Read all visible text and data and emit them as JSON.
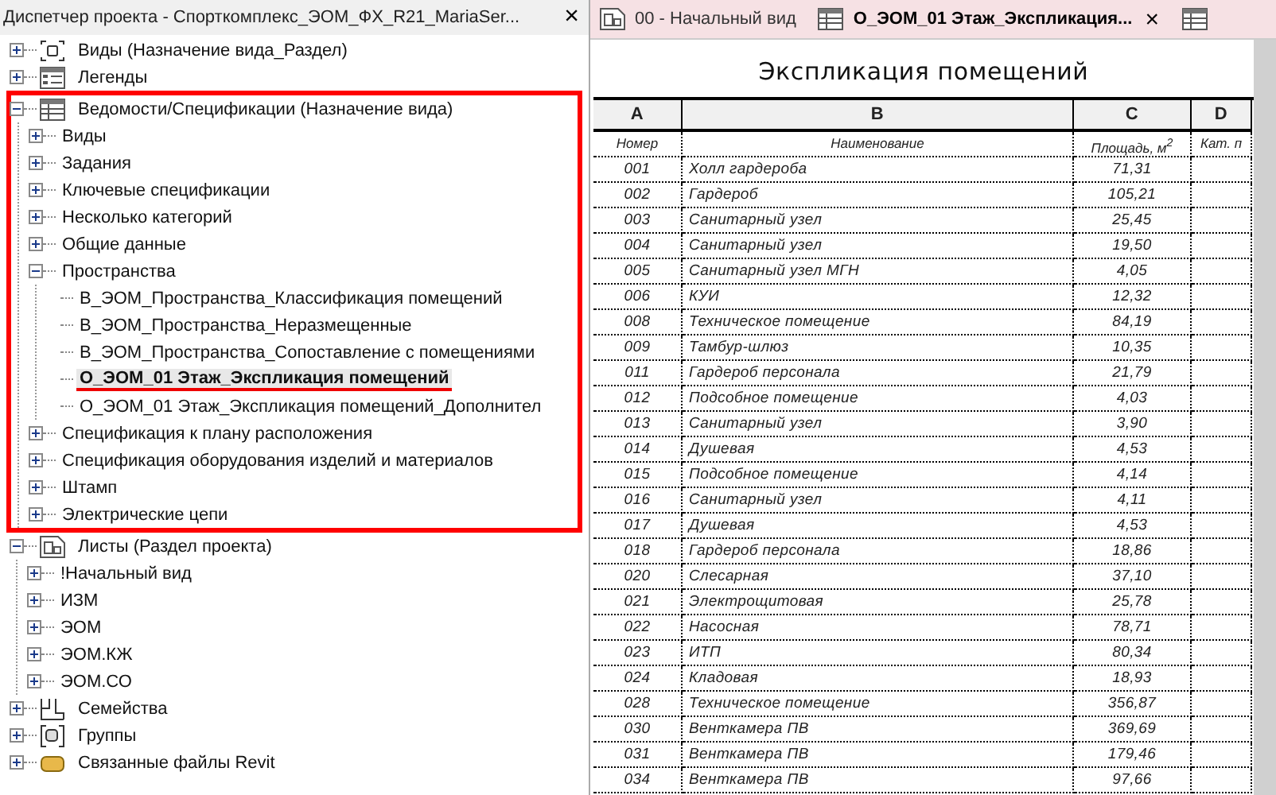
{
  "browser": {
    "title": "Диспетчер проекта - Спорткомплекс_ЭОМ_ФХ_R21_MariaSer...",
    "close": "×",
    "tree": [
      {
        "label": "Виды (Назначение вида_Раздел)",
        "kind": "views",
        "expanded": false,
        "selected": false
      },
      {
        "label": "Легенды",
        "kind": "legends",
        "expanded": false,
        "selected": false
      },
      {
        "label": "Ведомости/Спецификации (Назначение вида)",
        "kind": "schedules",
        "expanded": true,
        "selected": false,
        "highlighted": true,
        "children": [
          {
            "label": "Виды",
            "expanded": false,
            "selected": false
          },
          {
            "label": "Задания",
            "expanded": false,
            "selected": false
          },
          {
            "label": "Ключевые спецификации",
            "expanded": false,
            "selected": false
          },
          {
            "label": "Несколько категорий",
            "expanded": false,
            "selected": false
          },
          {
            "label": "Общие данные",
            "expanded": false,
            "selected": false
          },
          {
            "label": "Пространства",
            "expanded": true,
            "selected": false,
            "children": [
              {
                "label": "В_ЭОМ_Пространства_Классификация помещений",
                "selected": false
              },
              {
                "label": "В_ЭОМ_Пространства_Неразмещенные",
                "selected": false
              },
              {
                "label": "В_ЭОМ_Пространства_Сопоставление с помещениями",
                "selected": false
              },
              {
                "label": "О_ЭОМ_01 Этаж_Экспликация помещений",
                "selected": true,
                "underlined": true
              },
              {
                "label": "О_ЭОМ_01 Этаж_Экспликация помещений_Дополнител",
                "selected": false
              }
            ]
          },
          {
            "label": "Спецификация к плану расположения",
            "expanded": false,
            "selected": false
          },
          {
            "label": "Спецификация оборудования изделий и материалов",
            "expanded": false,
            "selected": false
          },
          {
            "label": "Штамп",
            "expanded": false,
            "selected": false
          },
          {
            "label": "Электрические цепи",
            "expanded": false,
            "selected": false
          }
        ]
      },
      {
        "label": "Листы (Раздел проекта)",
        "kind": "sheets",
        "expanded": true,
        "selected": false,
        "children": [
          {
            "label": "!Начальный вид",
            "expanded": false,
            "selected": false
          },
          {
            "label": "ИЗМ",
            "expanded": false,
            "selected": false
          },
          {
            "label": "ЭОМ",
            "expanded": false,
            "selected": false
          },
          {
            "label": "ЭОМ.КЖ",
            "expanded": false,
            "selected": false
          },
          {
            "label": "ЭОМ.СО",
            "expanded": false,
            "selected": false
          }
        ]
      },
      {
        "label": "Семейства",
        "kind": "families",
        "expanded": false,
        "selected": false
      },
      {
        "label": "Группы",
        "kind": "groups",
        "expanded": false,
        "selected": false
      },
      {
        "label": "Связанные файлы Revit",
        "kind": "links",
        "expanded": false,
        "selected": false
      }
    ]
  },
  "tabs": [
    {
      "label": "00 - Начальный вид",
      "kind": "sheet",
      "selected": false
    },
    {
      "label": "О_ЭОМ_01 Этаж_Экспликация...",
      "kind": "schedule",
      "selected": true,
      "close": "×"
    },
    {
      "kind": "schedule",
      "selected": false
    }
  ],
  "schedule": {
    "title": "Экспликация помещений",
    "column_letters": [
      "A",
      "B",
      "C",
      "D"
    ],
    "headers": [
      "Номер",
      "Наименование",
      "Площадь, м$^{2}$",
      "Кат. п"
    ],
    "rows": [
      [
        "001",
        "Холл гардероба",
        "71,31"
      ],
      [
        "002",
        "Гардероб",
        "105,21"
      ],
      [
        "003",
        "Санитарный узел",
        "25,45"
      ],
      [
        "004",
        "Санитарный узел",
        "19,50"
      ],
      [
        "005",
        "Санитарный узел МГН",
        "4,05"
      ],
      [
        "006",
        "КУИ",
        "12,32"
      ],
      [
        "008",
        "Техническое помещение",
        "84,19"
      ],
      [
        "009",
        "Тамбур-шлюз",
        "10,35"
      ],
      [
        "011",
        "Гардероб персонала",
        "21,79"
      ],
      [
        "012",
        "Подсобное помещение",
        "4,03"
      ],
      [
        "013",
        "Санитарный узел",
        "3,90"
      ],
      [
        "014",
        "Душевая",
        "4,53"
      ],
      [
        "015",
        "Подсобное помещение",
        "4,14"
      ],
      [
        "016",
        "Санитарный узел",
        "4,11"
      ],
      [
        "017",
        "Душевая",
        "4,53"
      ],
      [
        "018",
        "Гардероб персонала",
        "18,86"
      ],
      [
        "020",
        "Слесарная",
        "37,10"
      ],
      [
        "021",
        "Электрощитовая",
        "25,78"
      ],
      [
        "022",
        "Насосная",
        "78,71"
      ],
      [
        "023",
        "ИТП",
        "80,34"
      ],
      [
        "024",
        "Кладовая",
        "18,93"
      ],
      [
        "028",
        "Техническое помещение",
        "356,87"
      ],
      [
        "030",
        "Венткамера ПВ",
        "369,69"
      ],
      [
        "031",
        "Венткамера ПВ",
        "179,46"
      ],
      [
        "034",
        "Венткамера ПВ",
        "97,66"
      ]
    ]
  }
}
